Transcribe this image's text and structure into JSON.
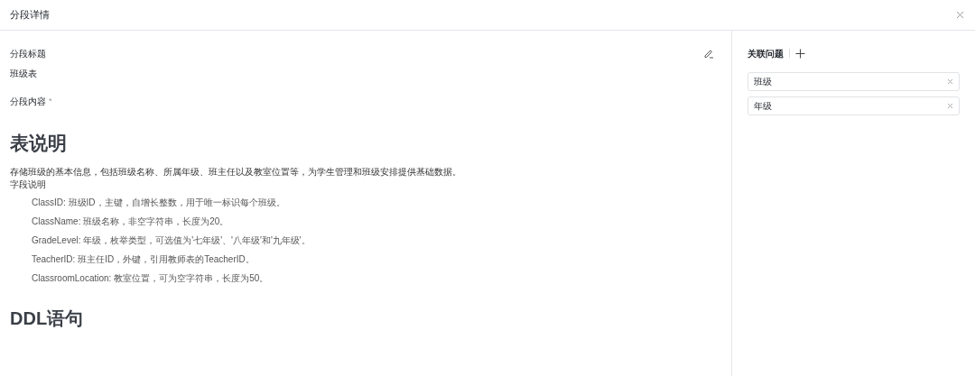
{
  "dialog": {
    "title": "分段详情"
  },
  "section_title": {
    "label": "分段标题",
    "value": "班级表"
  },
  "section_content": {
    "label": "分段内容",
    "required_mark": "*"
  },
  "content": {
    "heading": "表说明",
    "description": "存储班级的基本信息，包括班级名称、所属年级、班主任以及教室位置等，为学生管理和班级安排提供基础数据。",
    "fields_label": "字段说明",
    "fields": [
      "ClassID: 班级ID，主键，自增长整数，用于唯一标识每个班级。",
      "ClassName: 班级名称，非空字符串，长度为20。",
      "GradeLevel: 年级，枚举类型，可选值为'七年级'、'八年级'和'九年级'。",
      "TeacherID: 班主任ID，外键，引用教师表的TeacherID。",
      "ClassroomLocation: 教室位置，可为空字符串，长度为50。"
    ],
    "heading_2": "DDL语句"
  },
  "related_questions": {
    "title": "关联问题",
    "items": [
      "班级",
      "年级"
    ]
  }
}
